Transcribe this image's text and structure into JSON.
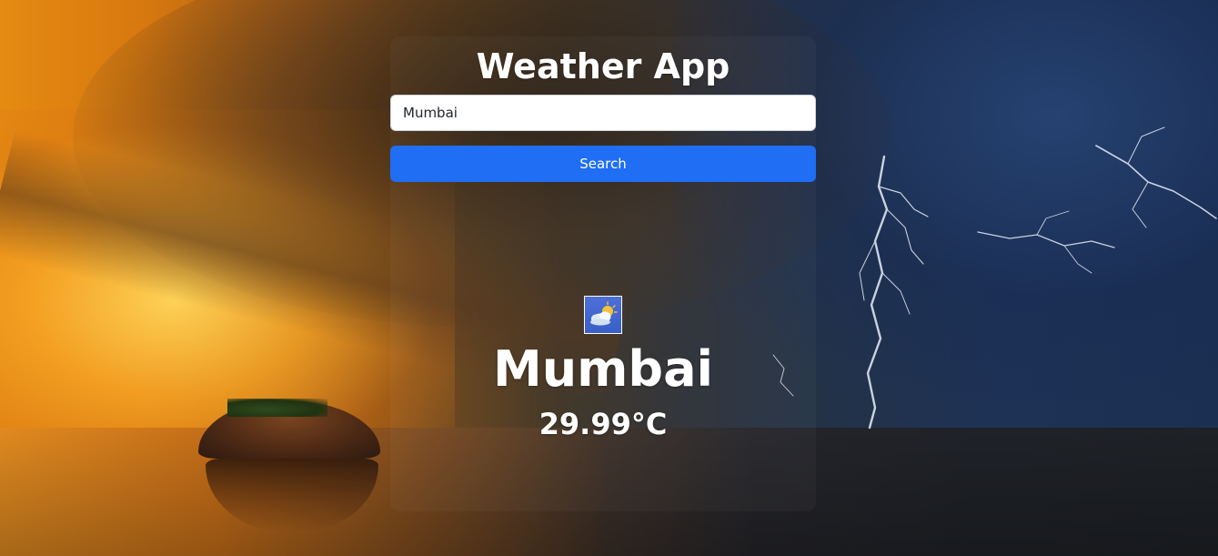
{
  "app": {
    "title": "Weather App"
  },
  "search": {
    "value": "Mumbai",
    "button_label": "Search"
  },
  "result": {
    "icon": "partly-cloudy-icon",
    "city": "Mumbai",
    "temperature": "29.99°C"
  },
  "colors": {
    "button": "#1f6ef4",
    "text": "#ffffff",
    "input_background": "#ffffff"
  }
}
